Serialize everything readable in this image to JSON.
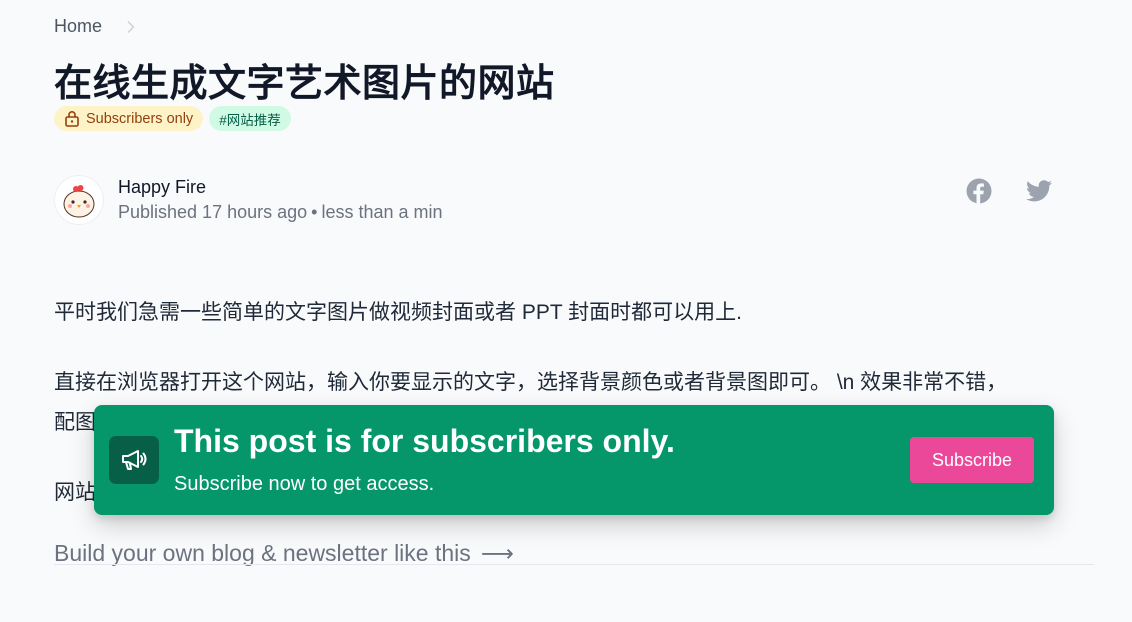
{
  "breadcrumb": {
    "home": "Home"
  },
  "post": {
    "title": "在线生成文字艺术图片的网站",
    "badges": {
      "subscribers": "Subscribers only",
      "tag": "#网站推荐"
    }
  },
  "author": {
    "name": "Happy Fire",
    "published": "Published 17 hours ago",
    "separator": "•",
    "read_time": "less than a min"
  },
  "share": {
    "icons": [
      "facebook-icon",
      "twitter-icon"
    ]
  },
  "content": {
    "p1": "平时我们急需一些简单的文字图片做视频封面或者 PPT 封面时都可以用上.",
    "p2_line1": "直接在浏览器打开这个网站，输入你要显示的文字，选择背景颜色或者背景图即可。 \\n 效果非常不错，",
    "p2_line2_visible": "配图",
    "p3_visible": "网站"
  },
  "paywall": {
    "title": "This post is for subscribers only.",
    "subtitle": "Subscribe now to get access.",
    "button": "Subscribe",
    "icon": "megaphone-icon"
  },
  "footer_cta": {
    "label": "Build your own blog & newsletter like this",
    "arrow": "⟶"
  },
  "colors": {
    "paywall_bg": "#059669",
    "paywall_icon_bg": "#065f46",
    "subscribe_button": "#ec4899",
    "badge_subscribers_bg": "#fef3c7",
    "badge_tag_bg": "#d1fae5"
  }
}
